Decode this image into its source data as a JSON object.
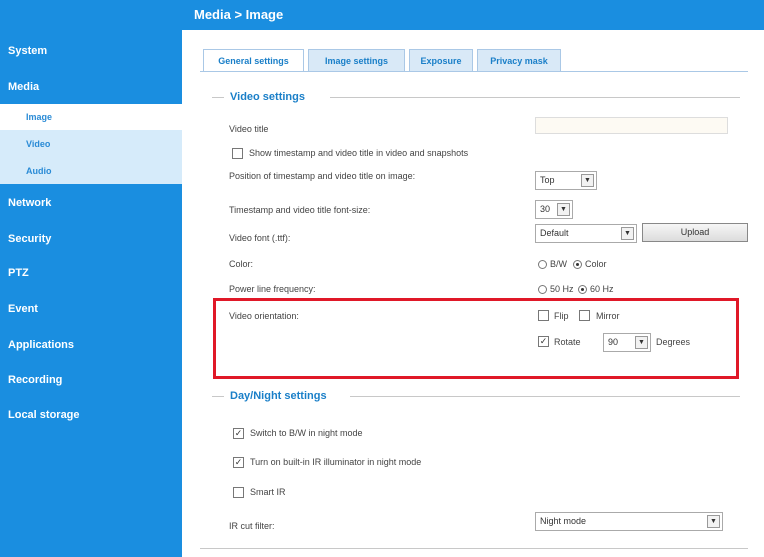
{
  "header": {
    "title": "Media > Image"
  },
  "sidebar": {
    "items": [
      {
        "label": "System"
      },
      {
        "label": "Media"
      },
      {
        "label": "Network"
      },
      {
        "label": "Security"
      },
      {
        "label": "PTZ"
      },
      {
        "label": "Event"
      },
      {
        "label": "Applications"
      },
      {
        "label": "Recording"
      },
      {
        "label": "Local storage"
      }
    ],
    "media_subitems": [
      {
        "label": "Image"
      },
      {
        "label": "Video"
      },
      {
        "label": "Audio"
      }
    ]
  },
  "tabs": [
    {
      "label": "General settings"
    },
    {
      "label": "Image settings"
    },
    {
      "label": "Exposure"
    },
    {
      "label": "Privacy mask"
    }
  ],
  "video_settings": {
    "heading": "Video settings",
    "video_title_label": "Video title",
    "video_title_value": "",
    "show_timestamp_label": "Show timestamp and video title in video and snapshots",
    "position_label": "Position of timestamp and video title on image:",
    "position_value": "Top",
    "fontsize_label": "Timestamp and video title font-size:",
    "fontsize_value": "30",
    "font_label": "Video font (.ttf):",
    "font_value": "Default",
    "upload_label": "Upload",
    "color_label": "Color:",
    "color_bw": "B/W",
    "color_color": "Color",
    "power_label": "Power line frequency:",
    "power_50": "50 Hz",
    "power_60": "60 Hz",
    "orientation_label": "Video orientation:",
    "flip_label": "Flip",
    "mirror_label": "Mirror",
    "rotate_label": "Rotate",
    "rotate_value": "90",
    "degrees_label": "Degrees"
  },
  "daynight": {
    "heading": "Day/Night settings",
    "switch_bw_label": "Switch to B/W in night mode",
    "ir_illuminator_label": "Turn on built-in IR illuminator in night mode",
    "smart_ir_label": "Smart IR",
    "ir_cut_label": "IR cut filter:",
    "ir_cut_value": "Night mode"
  },
  "icons": {
    "dropdown": "chevron-down-icon",
    "check": "check-icon"
  },
  "colors": {
    "accent": "#1a8ee0",
    "highlight": "#e01828"
  }
}
